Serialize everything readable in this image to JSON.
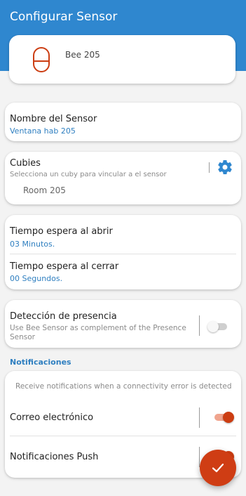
{
  "header": {
    "title": "Configurar Sensor"
  },
  "device": {
    "name": "Bee 205",
    "icon": "sensor-device-icon"
  },
  "sensor_name": {
    "label": "Nombre del Sensor",
    "value": "Ventana hab 205"
  },
  "cubies": {
    "label": "Cubies",
    "subtitle": "Selecciona un cuby para vincular a el sensor",
    "selected": "Room 205",
    "icon": "gear-icon"
  },
  "timers": {
    "open_label": "Tiempo espera al abrir",
    "open_value": "03 Minutos.",
    "close_label": "Tiempo espera al cerrar",
    "close_value": "00 Segundos."
  },
  "presence": {
    "label": "Detección de presencia",
    "description": "Use Bee Sensor as complement of the Presence Sensor",
    "enabled": false
  },
  "notifications": {
    "section_title": "Notificaciones",
    "info": "Receive notifications when a connectivity error is detected",
    "email_label": "Correo electrónico",
    "email_enabled": true,
    "push_label": "Notificaciones Push",
    "push_enabled": true
  },
  "fab": {
    "icon": "check-icon"
  },
  "colors": {
    "primary": "#2f87cf",
    "accent": "#cc3d12",
    "link": "#2f7fc0"
  }
}
